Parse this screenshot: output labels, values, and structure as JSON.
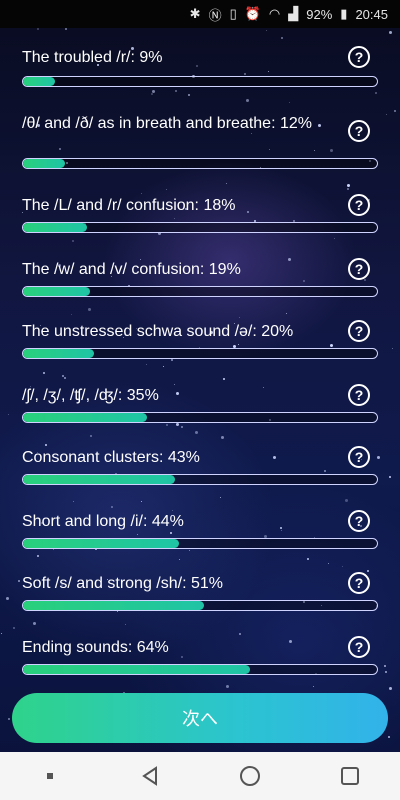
{
  "status_bar": {
    "icons": [
      "bluetooth-icon",
      "nfc-icon",
      "vibrate-icon",
      "alarm-icon",
      "wifi-icon",
      "signal-icon"
    ],
    "battery": "92%",
    "time": "20:45"
  },
  "items": [
    {
      "label": "The troubled /r/: 9%",
      "percent": 9
    },
    {
      "label": "/θ/ and /ð/ as in breath and breathe: 12%",
      "percent": 12
    },
    {
      "label": "The /L/ and /r/ confusion: 18%",
      "percent": 18
    },
    {
      "label": "The /w/ and /v/ confusion: 19%",
      "percent": 19
    },
    {
      "label": "The unstressed schwa sound /ə/: 20%",
      "percent": 20
    },
    {
      "label": "/ʃ/, /ʒ/, /ʧ/, /ʤ/: 35%",
      "percent": 35
    },
    {
      "label": "Consonant clusters: 43%",
      "percent": 43
    },
    {
      "label": "Short and long /i/: 44%",
      "percent": 44
    },
    {
      "label": "Soft /s/ and strong /sh/: 51%",
      "percent": 51
    },
    {
      "label": "Ending sounds: 64%",
      "percent": 64
    }
  ],
  "help_symbol": "?",
  "next_button": {
    "label": "次へ"
  },
  "colors": {
    "accent_start": "#29d07b",
    "accent_end": "#32b2ea"
  }
}
